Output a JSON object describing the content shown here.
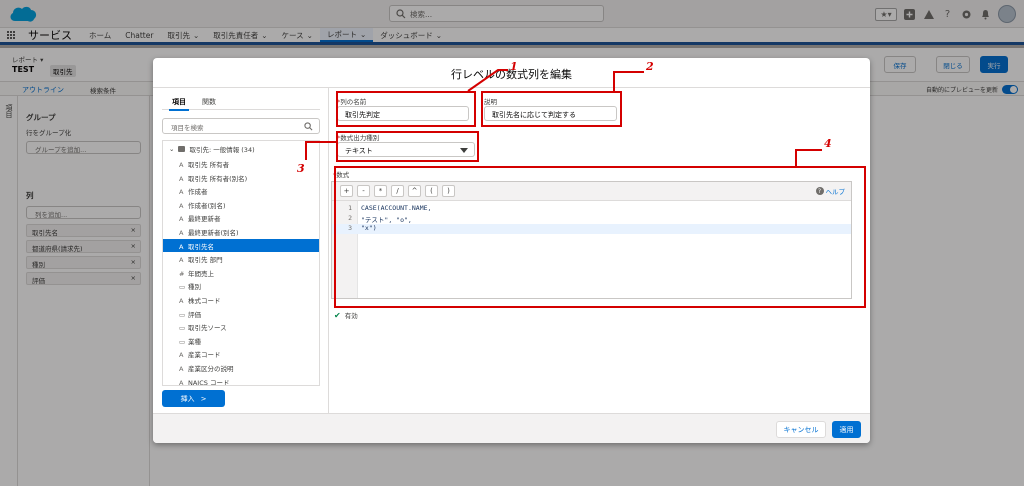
{
  "header": {
    "search_placeholder": "検索...",
    "icons": [
      "salesforce-cloud-icon",
      "search-icon",
      "favorites-star-icon",
      "add-icon",
      "trailhead-icon",
      "help-icon",
      "gear-icon",
      "bell-icon",
      "avatar"
    ],
    "help_glyph": "?"
  },
  "nav": {
    "app_name": "サービス",
    "items": [
      "ホーム",
      "Chatter",
      "取引先",
      "取引先責任者",
      "ケース",
      "レポート",
      "ダッシュボード"
    ],
    "active_index": 5
  },
  "report": {
    "type_label": "レポート ▾",
    "name": "TEST",
    "object_badge": "取引先",
    "buttons": [
      "保存",
      "閉じる",
      "実行"
    ],
    "outline_tab": "アウトライン",
    "filter_tab": "検索条件",
    "preview_label": "自動的にプレビューを更新",
    "fields_vertical": "項目",
    "group_heading": "グループ",
    "group_rows": "行をグループ化",
    "group_add": "グループを追加...",
    "columns_heading": "列",
    "column_add": "列を追加...",
    "columns": [
      "取引先名",
      "都道府県(請求先)",
      "種別",
      "評価"
    ]
  },
  "modal": {
    "title": "行レベルの数式列を編集",
    "tabs": [
      "項目",
      "関数"
    ],
    "field_search_placeholder": "項目を検索",
    "field_group": "取引先: 一般情報 (34)",
    "fields": [
      {
        "type": "A",
        "label": "取引先 所有者"
      },
      {
        "type": "A",
        "label": "取引先 所有者(別名)"
      },
      {
        "type": "A",
        "label": "作成者"
      },
      {
        "type": "A",
        "label": "作成者(別名)"
      },
      {
        "type": "A",
        "label": "最終更新者"
      },
      {
        "type": "A",
        "label": "最終更新者(別名)"
      },
      {
        "type": "A",
        "label": "取引先名"
      },
      {
        "type": "A",
        "label": "取引先 部門"
      },
      {
        "type": "#",
        "label": "年間売上"
      },
      {
        "type": "▭",
        "label": "種別"
      },
      {
        "type": "A",
        "label": "株式コード"
      },
      {
        "type": "▭",
        "label": "評価"
      },
      {
        "type": "▭",
        "label": "取引先ソース"
      },
      {
        "type": "▭",
        "label": "業種"
      },
      {
        "type": "A",
        "label": "産業コード"
      },
      {
        "type": "A",
        "label": "産業区分の説明"
      },
      {
        "type": "A",
        "label": "NAICS コード"
      }
    ],
    "selected_field_index": 6,
    "insert_label": "挿入",
    "insert_arrow": ">",
    "column_name_label": "列の名前",
    "column_name_value": "取引先判定",
    "description_label": "説明",
    "description_value": "取引先名に応じて判定する",
    "output_type_label": "数式出力種別",
    "output_type_value": "テキスト",
    "formula_label": "数式",
    "required_mark": "*",
    "operators": [
      "+",
      "-",
      "*",
      "/",
      "^",
      "(",
      ")"
    ],
    "help_label": "ヘルプ",
    "code_lines": [
      {
        "no": "1",
        "text": "CASE(ACCOUNT.NAME,"
      },
      {
        "no": "2",
        "text": "\"テスト\", \"o\","
      },
      {
        "no": "3",
        "text": "\"x\")"
      }
    ],
    "valid_label": "有効",
    "cancel_label": "キャンセル",
    "apply_label": "適用"
  },
  "annotations": [
    "1",
    "2",
    "3",
    "4"
  ],
  "colors": {
    "brand": "#0070d2",
    "annotation": "#d40000",
    "nav_active": "#1b5297"
  }
}
